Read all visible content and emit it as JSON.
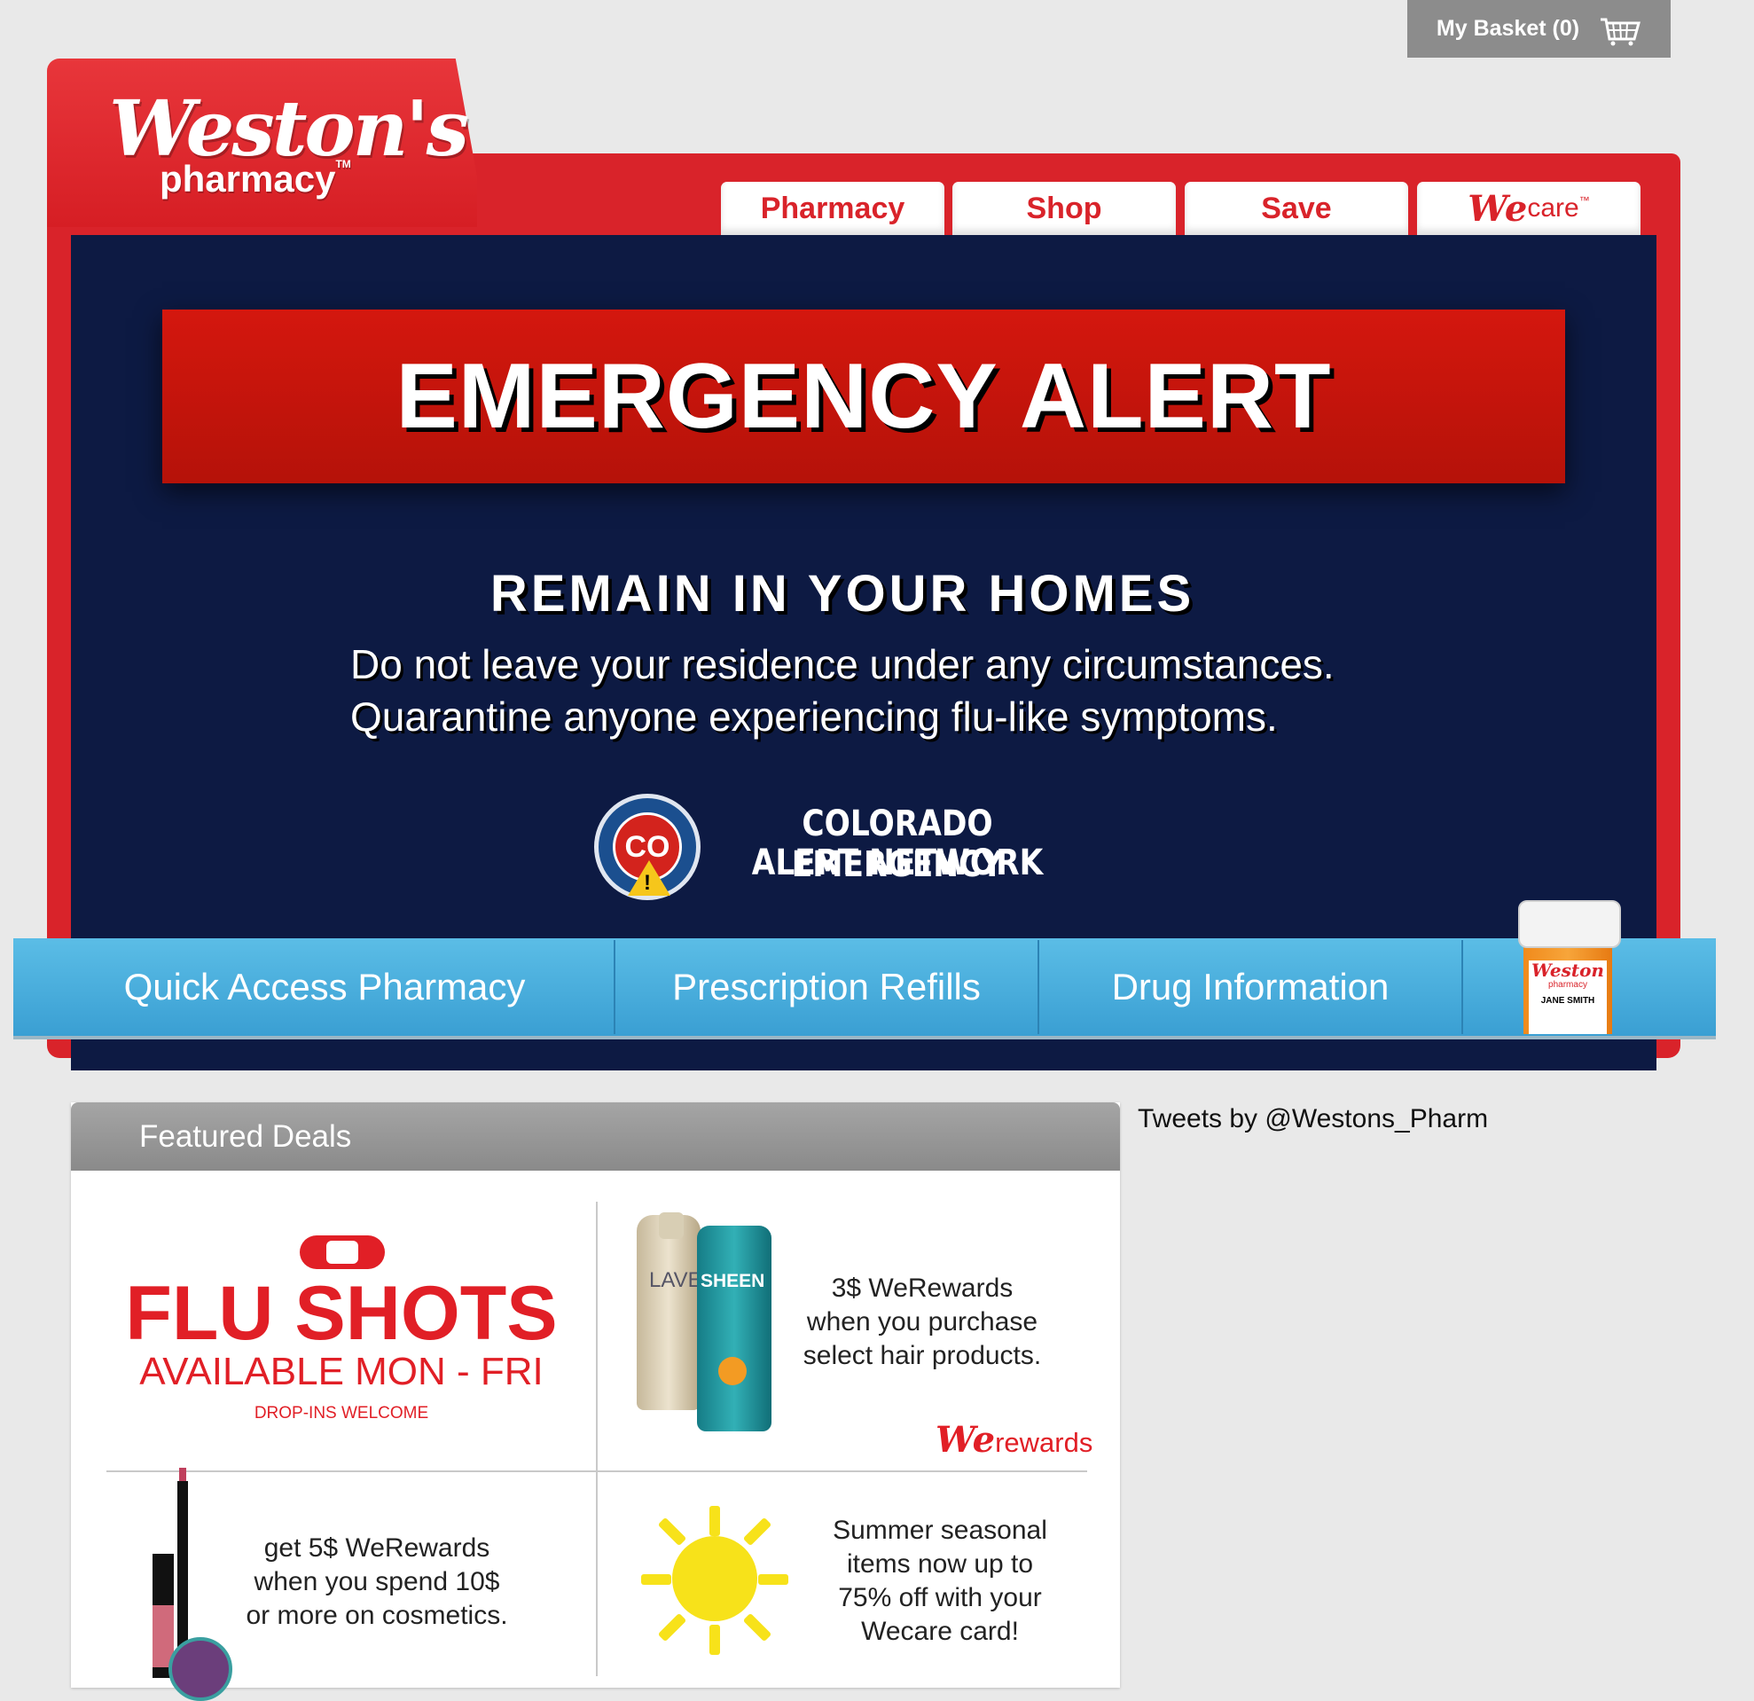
{
  "basket": {
    "label": "My Basket (0)",
    "icon": "basket-icon"
  },
  "logo": {
    "name": "Weston's",
    "sub": "pharmacy",
    "tm": "TM"
  },
  "tabs": [
    {
      "label": "Pharmacy"
    },
    {
      "label": "Shop"
    },
    {
      "label": "Save"
    },
    {
      "we": "We",
      "care": "care",
      "tm": "™"
    }
  ],
  "alert": {
    "title": "EMERGENCY ALERT",
    "headline": "REMAIN IN YOUR HOMES",
    "lines": [
      "Do not leave your residence under any circumstances.",
      "Quarantine anyone experiencing flu-like symptoms."
    ],
    "seal_text": "CO",
    "network_lines": [
      "COLORADO EMERGENCY",
      "ALERT NETWORK"
    ]
  },
  "nav": [
    {
      "label": "Quick Access Pharmacy"
    },
    {
      "label": "Prescription Refills"
    },
    {
      "label": "Drug Information"
    }
  ],
  "bottle": {
    "brand": "Weston",
    "sub": "pharmacy",
    "patient": "JANE SMITH"
  },
  "deals": {
    "title": "Featured Deals",
    "flu": {
      "title": "FLU SHOTS",
      "subtitle": "AVAILABLE MON - FRI",
      "note": "DROP-INS WELCOME"
    },
    "hair": {
      "lines": [
        "3$ WeRewards",
        "when you purchase",
        "select hair products."
      ],
      "brand_we": "We",
      "brand_rest": "rewards",
      "bottle_a": "LAVE",
      "bottle_b": "SHEEN"
    },
    "cosmetics": {
      "lines": [
        "get 5$ WeRewards",
        "when you spend 10$",
        "or more on cosmetics."
      ]
    },
    "summer": {
      "lines": [
        "Summer seasonal",
        "items now up to",
        "75% off with your",
        "Wecare card!"
      ]
    }
  },
  "tweets": {
    "label": "Tweets by @Westons_Pharm"
  },
  "colors": {
    "brand_red": "#d9232a",
    "navy": "#0d1a43",
    "nav_blue": "#4aafdd",
    "alert_red": "#c8150c"
  }
}
